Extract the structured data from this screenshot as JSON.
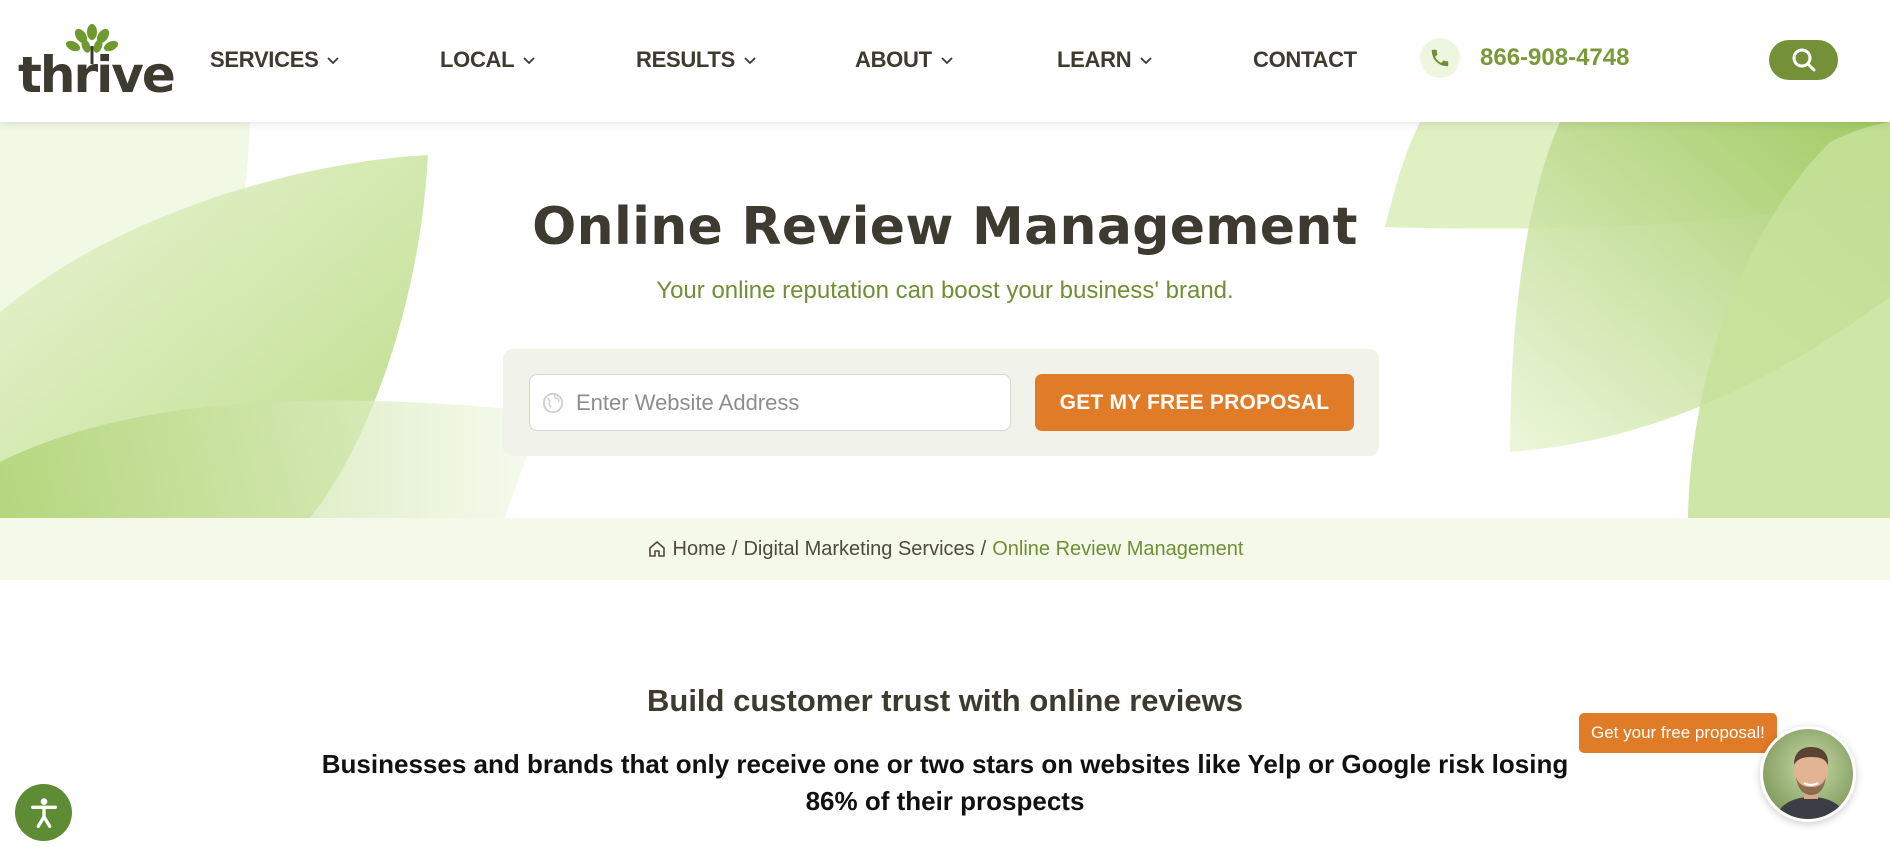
{
  "brand": {
    "logo_text": "thrive"
  },
  "nav": {
    "items": [
      {
        "label": "SERVICES",
        "has_dropdown": true
      },
      {
        "label": "LOCAL",
        "has_dropdown": true
      },
      {
        "label": "RESULTS",
        "has_dropdown": true
      },
      {
        "label": "ABOUT",
        "has_dropdown": true
      },
      {
        "label": "LEARN",
        "has_dropdown": true
      },
      {
        "label": "CONTACT",
        "has_dropdown": false
      }
    ],
    "phone": "866-908-4748"
  },
  "hero": {
    "title": "Online Review Management",
    "subtitle": "Your online reputation can boost your business' brand.",
    "input_placeholder": "Enter Website Address",
    "input_value": "",
    "cta_label": "GET MY FREE PROPOSAL"
  },
  "breadcrumb": {
    "home": "Home",
    "parent": "Digital Marketing Services",
    "current": "Online Review Management",
    "separator": "/"
  },
  "content": {
    "heading": "Build customer trust with online reviews",
    "text": "Businesses and brands that only receive one or two stars on websites like Yelp or Google risk losing 86% of their prospects"
  },
  "chat": {
    "bubble_text": "Get your free proposal!"
  },
  "colors": {
    "brand_green": "#74913a",
    "accent_orange": "#e07b27",
    "text_dark": "#3d3a2f"
  }
}
